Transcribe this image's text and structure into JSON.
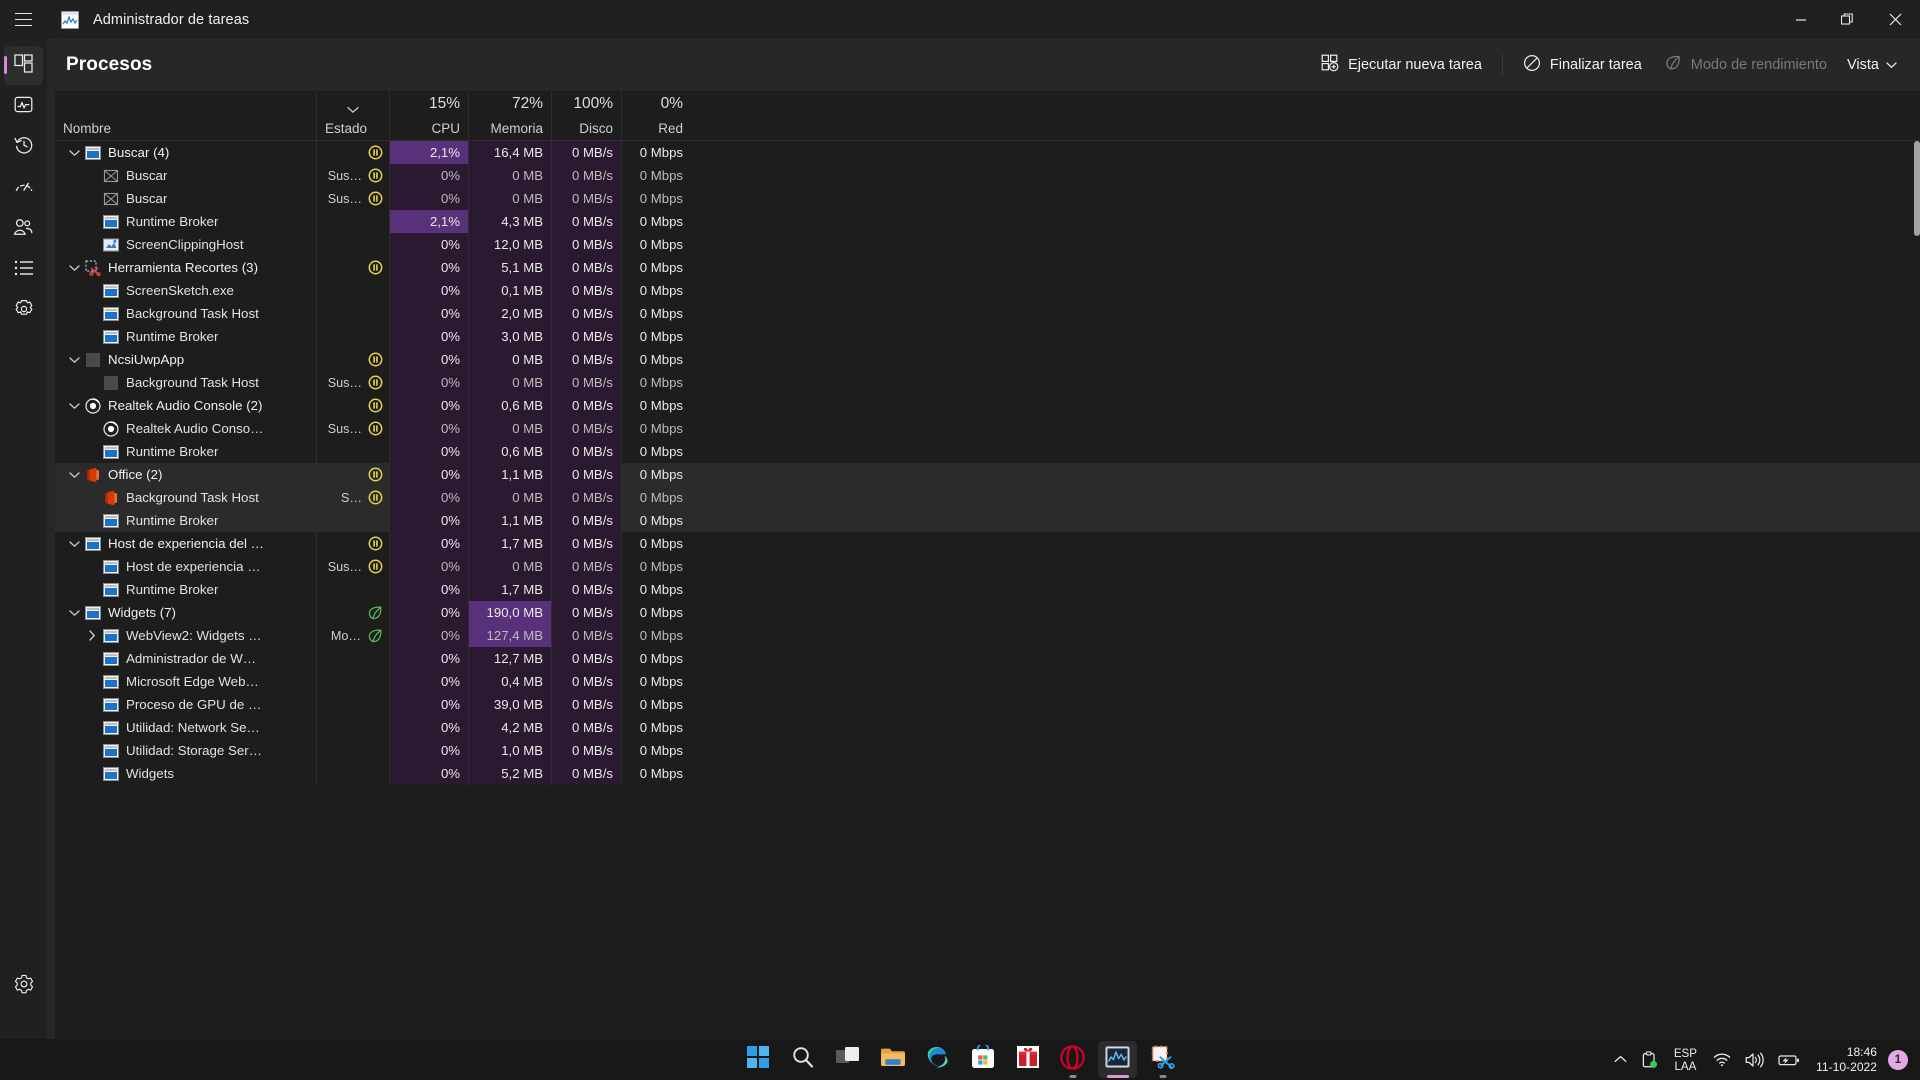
{
  "window": {
    "title": "Administrador de tareas",
    "icon": "task-manager-icon",
    "menu_icon": "hamburger-menu-icon",
    "controls": {
      "minimize": "minimize-icon",
      "restore": "restore-icon",
      "close": "close-icon"
    }
  },
  "rail": {
    "items": [
      {
        "name": "processes",
        "icon": "processes-icon",
        "active": true
      },
      {
        "name": "performance",
        "icon": "performance-icon",
        "active": false
      },
      {
        "name": "app-history",
        "icon": "app-history-icon",
        "active": false
      },
      {
        "name": "startup-apps",
        "icon": "startup-apps-icon",
        "active": false
      },
      {
        "name": "users",
        "icon": "users-icon",
        "active": false
      },
      {
        "name": "details",
        "icon": "details-icon",
        "active": false
      },
      {
        "name": "services",
        "icon": "services-icon",
        "active": false
      }
    ],
    "settings": {
      "name": "settings",
      "icon": "gear-icon"
    },
    "accent_color": "#d48bd6"
  },
  "toolbar": {
    "page_title": "Procesos",
    "run_new_task": "Ejecutar nueva tarea",
    "end_task": "Finalizar tarea",
    "efficiency_mode": "Modo de rendimiento",
    "efficiency_mode_disabled": true,
    "view": "Vista"
  },
  "table": {
    "columns": [
      {
        "key": "nombre",
        "label": "Nombre",
        "pct": "",
        "align": "left"
      },
      {
        "key": "estado",
        "label": "Estado",
        "pct": "",
        "align": "left",
        "sorted": true
      },
      {
        "key": "cpu",
        "label": "CPU",
        "pct": "15%",
        "align": "right"
      },
      {
        "key": "memoria",
        "label": "Memoria",
        "pct": "72%",
        "align": "right"
      },
      {
        "key": "disco",
        "label": "Disco",
        "pct": "100%",
        "align": "right"
      },
      {
        "key": "red",
        "label": "Red",
        "pct": "0%",
        "align": "right"
      }
    ],
    "rows": [
      {
        "name": "Buscar (4)",
        "level": 0,
        "twisty": "expanded",
        "icon": "window-blue-icon",
        "estado": "",
        "status_icon": "pause-icon",
        "cpu": "2,1%",
        "mem": "16,4 MB",
        "disk": "0 MB/s",
        "net": "0 Mbps",
        "cpu_heat": 2,
        "mem_heat": 1,
        "disk_heat": 1,
        "net_heat": 0,
        "selected": false
      },
      {
        "name": "Buscar",
        "level": 1,
        "twisty": "none",
        "icon": "placeholder-x-icon",
        "estado": "Sus…",
        "status_icon": "pause-icon",
        "cpu": "0%",
        "mem": "0 MB",
        "disk": "0 MB/s",
        "net": "0 Mbps",
        "cpu_heat": 1,
        "mem_heat": 1,
        "disk_heat": 1,
        "net_heat": 0,
        "dim": true,
        "selected": false
      },
      {
        "name": "Buscar",
        "level": 1,
        "twisty": "none",
        "icon": "placeholder-x-icon",
        "estado": "Sus…",
        "status_icon": "pause-icon",
        "cpu": "0%",
        "mem": "0 MB",
        "disk": "0 MB/s",
        "net": "0 Mbps",
        "cpu_heat": 1,
        "mem_heat": 1,
        "disk_heat": 1,
        "net_heat": 0,
        "dim": true,
        "selected": false
      },
      {
        "name": "Runtime Broker",
        "level": 1,
        "twisty": "none",
        "icon": "window-blue-icon",
        "estado": "",
        "status_icon": "",
        "cpu": "2,1%",
        "mem": "4,3 MB",
        "disk": "0 MB/s",
        "net": "0 Mbps",
        "cpu_heat": 2,
        "mem_heat": 1,
        "disk_heat": 1,
        "net_heat": 0,
        "selected": false
      },
      {
        "name": "ScreenClippingHost",
        "level": 1,
        "twisty": "none",
        "icon": "screenclip-icon",
        "estado": "",
        "status_icon": "",
        "cpu": "0%",
        "mem": "12,0 MB",
        "disk": "0 MB/s",
        "net": "0 Mbps",
        "cpu_heat": 1,
        "mem_heat": 1,
        "disk_heat": 1,
        "net_heat": 0,
        "selected": false
      },
      {
        "name": "Herramienta Recortes (3)",
        "level": 0,
        "twisty": "expanded",
        "icon": "snipping-tool-icon",
        "estado": "",
        "status_icon": "pause-icon",
        "cpu": "0%",
        "mem": "5,1 MB",
        "disk": "0 MB/s",
        "net": "0 Mbps",
        "cpu_heat": 1,
        "mem_heat": 1,
        "disk_heat": 1,
        "net_heat": 0,
        "selected": false
      },
      {
        "name": "ScreenSketch.exe",
        "level": 1,
        "twisty": "none",
        "icon": "window-blue-icon",
        "estado": "",
        "status_icon": "",
        "cpu": "0%",
        "mem": "0,1 MB",
        "disk": "0 MB/s",
        "net": "0 Mbps",
        "cpu_heat": 1,
        "mem_heat": 1,
        "disk_heat": 1,
        "net_heat": 0,
        "selected": false
      },
      {
        "name": "Background Task Host",
        "level": 1,
        "twisty": "none",
        "icon": "window-blue-icon",
        "estado": "",
        "status_icon": "",
        "cpu": "0%",
        "mem": "2,0 MB",
        "disk": "0 MB/s",
        "net": "0 Mbps",
        "cpu_heat": 1,
        "mem_heat": 1,
        "disk_heat": 1,
        "net_heat": 0,
        "selected": false
      },
      {
        "name": "Runtime Broker",
        "level": 1,
        "twisty": "none",
        "icon": "window-blue-icon",
        "estado": "",
        "status_icon": "",
        "cpu": "0%",
        "mem": "3,0 MB",
        "disk": "0 MB/s",
        "net": "0 Mbps",
        "cpu_heat": 1,
        "mem_heat": 1,
        "disk_heat": 1,
        "net_heat": 0,
        "selected": false
      },
      {
        "name": "NcsiUwpApp",
        "level": 0,
        "twisty": "expanded",
        "icon": "generic-gray-icon",
        "estado": "",
        "status_icon": "pause-icon",
        "cpu": "0%",
        "mem": "0 MB",
        "disk": "0 MB/s",
        "net": "0 Mbps",
        "cpu_heat": 1,
        "mem_heat": 1,
        "disk_heat": 1,
        "net_heat": 0,
        "selected": false
      },
      {
        "name": "Background Task Host",
        "level": 1,
        "twisty": "none",
        "icon": "generic-gray-icon",
        "estado": "Sus…",
        "status_icon": "pause-icon",
        "cpu": "0%",
        "mem": "0 MB",
        "disk": "0 MB/s",
        "net": "0 Mbps",
        "cpu_heat": 1,
        "mem_heat": 1,
        "disk_heat": 1,
        "net_heat": 0,
        "dim": true,
        "selected": false
      },
      {
        "name": "Realtek Audio Console (2)",
        "level": 0,
        "twisty": "expanded",
        "icon": "realtek-icon",
        "estado": "",
        "status_icon": "pause-icon",
        "cpu": "0%",
        "mem": "0,6 MB",
        "disk": "0 MB/s",
        "net": "0 Mbps",
        "cpu_heat": 1,
        "mem_heat": 1,
        "disk_heat": 1,
        "net_heat": 0,
        "selected": false
      },
      {
        "name": "Realtek Audio Conso…",
        "level": 1,
        "twisty": "none",
        "icon": "realtek-icon",
        "estado": "Sus…",
        "status_icon": "pause-icon",
        "cpu": "0%",
        "mem": "0 MB",
        "disk": "0 MB/s",
        "net": "0 Mbps",
        "cpu_heat": 1,
        "mem_heat": 1,
        "disk_heat": 1,
        "net_heat": 0,
        "dim": true,
        "selected": false
      },
      {
        "name": "Runtime Broker",
        "level": 1,
        "twisty": "none",
        "icon": "window-blue-icon",
        "estado": "",
        "status_icon": "",
        "cpu": "0%",
        "mem": "0,6 MB",
        "disk": "0 MB/s",
        "net": "0 Mbps",
        "cpu_heat": 1,
        "mem_heat": 1,
        "disk_heat": 1,
        "net_heat": 0,
        "selected": false
      },
      {
        "name": "Office (2)",
        "level": 0,
        "twisty": "expanded",
        "icon": "office-icon",
        "estado": "",
        "status_icon": "pause-icon",
        "cpu": "0%",
        "mem": "1,1 MB",
        "disk": "0 MB/s",
        "net": "0 Mbps",
        "cpu_heat": 1,
        "mem_heat": 1,
        "disk_heat": 1,
        "net_heat": 0,
        "selected": true
      },
      {
        "name": "Background Task Host",
        "level": 1,
        "twisty": "none",
        "icon": "office-icon",
        "estado": "S…",
        "status_icon": "pause-icon",
        "cpu": "0%",
        "mem": "0 MB",
        "disk": "0 MB/s",
        "net": "0 Mbps",
        "cpu_heat": 1,
        "mem_heat": 1,
        "disk_heat": 1,
        "net_heat": 0,
        "dim": true,
        "selected": true
      },
      {
        "name": "Runtime Broker",
        "level": 1,
        "twisty": "none",
        "icon": "window-blue-icon",
        "estado": "",
        "status_icon": "",
        "cpu": "0%",
        "mem": "1,1 MB",
        "disk": "0 MB/s",
        "net": "0 Mbps",
        "cpu_heat": 1,
        "mem_heat": 1,
        "disk_heat": 1,
        "net_heat": 0,
        "selected": true
      },
      {
        "name": "Host de experiencia del …",
        "level": 0,
        "twisty": "expanded",
        "icon": "window-blue-icon",
        "estado": "",
        "status_icon": "pause-icon",
        "cpu": "0%",
        "mem": "1,7 MB",
        "disk": "0 MB/s",
        "net": "0 Mbps",
        "cpu_heat": 1,
        "mem_heat": 1,
        "disk_heat": 1,
        "net_heat": 0,
        "selected": false
      },
      {
        "name": "Host de experiencia …",
        "level": 1,
        "twisty": "none",
        "icon": "window-blue-icon",
        "estado": "Sus…",
        "status_icon": "pause-icon",
        "cpu": "0%",
        "mem": "0 MB",
        "disk": "0 MB/s",
        "net": "0 Mbps",
        "cpu_heat": 1,
        "mem_heat": 1,
        "disk_heat": 1,
        "net_heat": 0,
        "dim": true,
        "selected": false
      },
      {
        "name": "Runtime Broker",
        "level": 1,
        "twisty": "none",
        "icon": "window-blue-icon",
        "estado": "",
        "status_icon": "",
        "cpu": "0%",
        "mem": "1,7 MB",
        "disk": "0 MB/s",
        "net": "0 Mbps",
        "cpu_heat": 1,
        "mem_heat": 1,
        "disk_heat": 1,
        "net_heat": 0,
        "selected": false
      },
      {
        "name": "Widgets (7)",
        "level": 0,
        "twisty": "expanded",
        "icon": "window-blue-icon",
        "estado": "",
        "status_icon": "leaf-icon",
        "cpu": "0%",
        "mem": "190,0 MB",
        "disk": "0 MB/s",
        "net": "0 Mbps",
        "cpu_heat": 1,
        "mem_heat": 2,
        "disk_heat": 1,
        "net_heat": 0,
        "selected": false
      },
      {
        "name": "WebView2: Widgets …",
        "level": 1,
        "twisty": "collapsed",
        "icon": "window-blue-icon",
        "estado": "Mo…",
        "status_icon": "leaf-icon",
        "cpu": "0%",
        "mem": "127,4 MB",
        "disk": "0 MB/s",
        "net": "0 Mbps",
        "cpu_heat": 1,
        "mem_heat": 2,
        "disk_heat": 1,
        "net_heat": 0,
        "dim": true,
        "selected": false
      },
      {
        "name": "Administrador de W…",
        "level": 1,
        "twisty": "none",
        "icon": "window-blue-icon",
        "estado": "",
        "status_icon": "",
        "cpu": "0%",
        "mem": "12,7 MB",
        "disk": "0 MB/s",
        "net": "0 Mbps",
        "cpu_heat": 1,
        "mem_heat": 1,
        "disk_heat": 1,
        "net_heat": 0,
        "selected": false
      },
      {
        "name": "Microsoft Edge Web…",
        "level": 1,
        "twisty": "none",
        "icon": "window-blue-icon",
        "estado": "",
        "status_icon": "",
        "cpu": "0%",
        "mem": "0,4 MB",
        "disk": "0 MB/s",
        "net": "0 Mbps",
        "cpu_heat": 1,
        "mem_heat": 1,
        "disk_heat": 1,
        "net_heat": 0,
        "selected": false
      },
      {
        "name": "Proceso de GPU de …",
        "level": 1,
        "twisty": "none",
        "icon": "window-blue-icon",
        "estado": "",
        "status_icon": "",
        "cpu": "0%",
        "mem": "39,0 MB",
        "disk": "0 MB/s",
        "net": "0 Mbps",
        "cpu_heat": 1,
        "mem_heat": 1,
        "disk_heat": 1,
        "net_heat": 0,
        "selected": false
      },
      {
        "name": "Utilidad: Network Se…",
        "level": 1,
        "twisty": "none",
        "icon": "window-blue-icon",
        "estado": "",
        "status_icon": "",
        "cpu": "0%",
        "mem": "4,2 MB",
        "disk": "0 MB/s",
        "net": "0 Mbps",
        "cpu_heat": 1,
        "mem_heat": 1,
        "disk_heat": 1,
        "net_heat": 0,
        "selected": false
      },
      {
        "name": "Utilidad: Storage Ser…",
        "level": 1,
        "twisty": "none",
        "icon": "window-blue-icon",
        "estado": "",
        "status_icon": "",
        "cpu": "0%",
        "mem": "1,0 MB",
        "disk": "0 MB/s",
        "net": "0 Mbps",
        "cpu_heat": 1,
        "mem_heat": 1,
        "disk_heat": 1,
        "net_heat": 0,
        "selected": false
      },
      {
        "name": "Widgets",
        "level": 1,
        "twisty": "none",
        "icon": "window-blue-icon",
        "estado": "",
        "status_icon": "",
        "cpu": "0%",
        "mem": "5,2 MB",
        "disk": "0 MB/s",
        "net": "0 Mbps",
        "cpu_heat": 1,
        "mem_heat": 1,
        "disk_heat": 1,
        "net_heat": 0,
        "selected": false
      }
    ],
    "heat_colors": {
      "0": "transparent",
      "1": "#2a1930",
      "2": "#59317a"
    }
  },
  "taskbar": {
    "icons": [
      {
        "name": "start-icon",
        "active": false
      },
      {
        "name": "search-icon",
        "active": false
      },
      {
        "name": "task-view-icon",
        "active": false
      },
      {
        "name": "file-explorer-icon",
        "active": false
      },
      {
        "name": "microsoft-edge-icon",
        "active": false
      },
      {
        "name": "microsoft-store-icon",
        "active": false
      },
      {
        "name": "gift-icon",
        "active": false
      },
      {
        "name": "opera-icon",
        "active": false,
        "underline": "dot"
      },
      {
        "name": "task-manager-icon",
        "active": true,
        "underline": "wide"
      },
      {
        "name": "snipping-tool-icon",
        "active": false,
        "underline": "dot"
      }
    ],
    "tray": {
      "chevron": "show-hidden-icons-icon",
      "clipboard": "clipboard-icon",
      "language_primary": "ESP",
      "language_secondary": "LAA",
      "wifi": "wifi-icon",
      "volume": "volume-icon",
      "battery": "battery-charging-icon",
      "time": "18:46",
      "date": "11-10-2022",
      "notification_count": "1"
    }
  }
}
